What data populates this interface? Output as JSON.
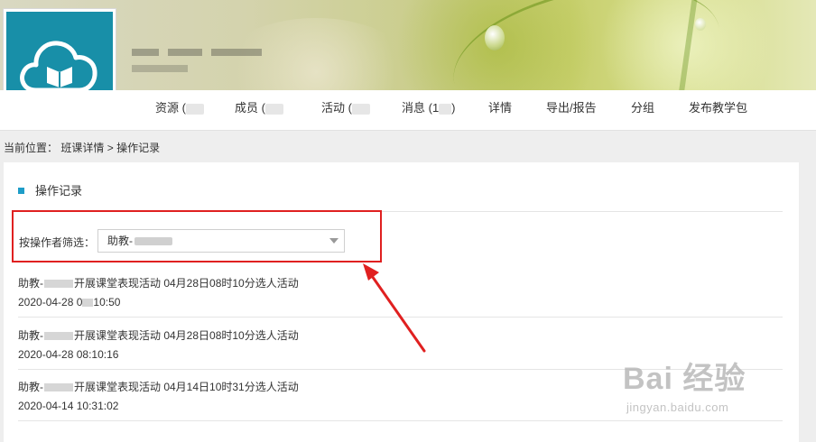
{
  "nav": {
    "items": [
      {
        "label": "资源 (",
        "blurred": true
      },
      {
        "label": "成员 (",
        "blurred": true
      },
      {
        "label": "活动 (",
        "blurred": true
      },
      {
        "label": "消息 (1",
        "suffix": ")"
      },
      {
        "label": "详情"
      },
      {
        "label": "导出/报告"
      },
      {
        "label": "分组"
      },
      {
        "label": "发布教学包"
      }
    ]
  },
  "breadcrumb": {
    "prefix": "当前位置：",
    "link": "班课详情",
    "separator": " > ",
    "current": "操作记录"
  },
  "panel": {
    "title": "操作记录",
    "filter_label": "按操作者筛选：",
    "filter_value": "助教-"
  },
  "records": [
    {
      "actor": "助教-",
      "action": "开展课堂表现活动 04月28日08时10分选人活动",
      "time_a": "2020-04-28 0",
      "time_b": "10:50"
    },
    {
      "actor": "助教-",
      "action": "开展课堂表现活动 04月28日08时10分选人活动",
      "time": "2020-04-28 08:10:16"
    },
    {
      "actor": "助教-",
      "action": "开展课堂表现活动 04月14日10时31分选人活动",
      "time": "2020-04-14 10:31:02"
    }
  ],
  "watermark": {
    "main": "Bai  经验",
    "sub": "jingyan.baidu.com"
  },
  "colors": {
    "logo_bg": "#188fa8",
    "accent": "#1e9dc8",
    "highlight": "#e02020"
  },
  "icons": {
    "logo": "cloud-book-icon",
    "dropdown": "caret-down-icon",
    "arrow": "red-arrow-annotation"
  }
}
